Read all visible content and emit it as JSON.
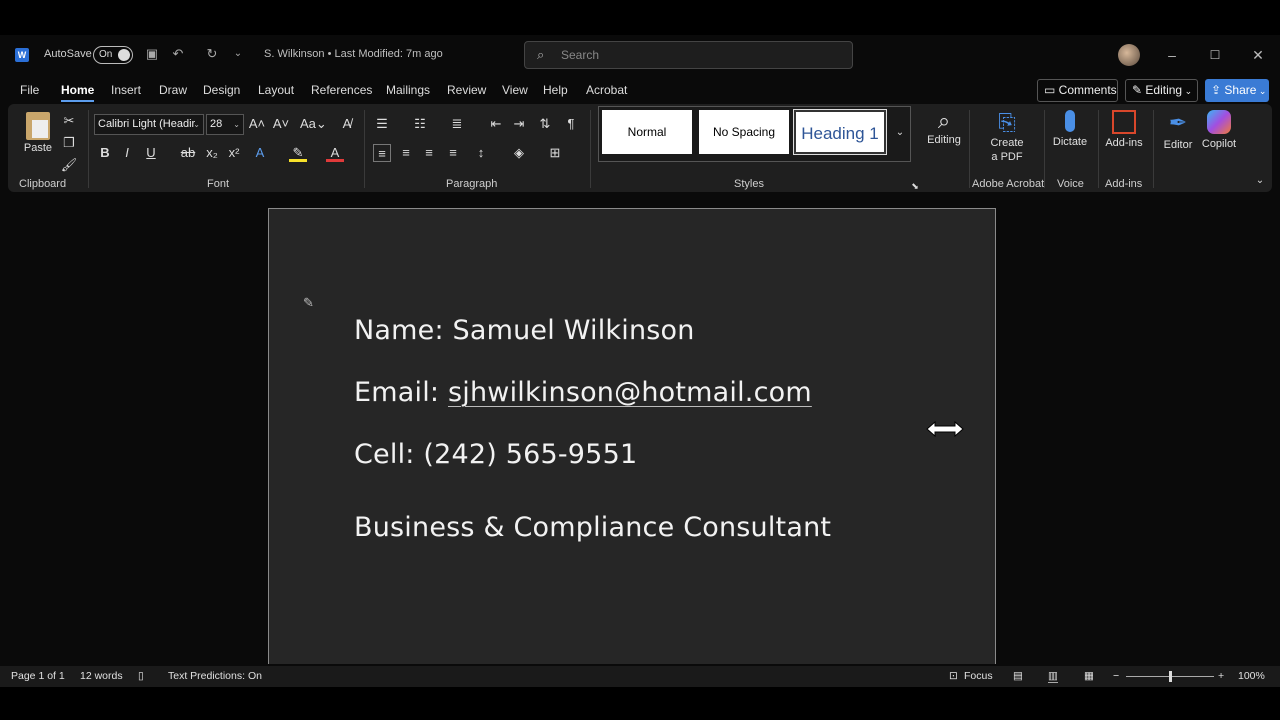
{
  "titlebar": {
    "autosave_label": "AutoSave",
    "autosave_state": "On",
    "doc_title": "S. Wilkinson  •  Last Modified: 7m ago",
    "search_placeholder": "Search"
  },
  "tabs": [
    "File",
    "Home",
    "Insert",
    "Draw",
    "Design",
    "Layout",
    "References",
    "Mailings",
    "Review",
    "View",
    "Help",
    "Acrobat"
  ],
  "active_tab": "Home",
  "actions": {
    "comments": "Comments",
    "editing": "Editing",
    "share": "Share"
  },
  "ribbon": {
    "clipboard": {
      "paste": "Paste",
      "label": "Clipboard"
    },
    "font": {
      "family": "Calibri Light (Headir",
      "size": "28",
      "label": "Font"
    },
    "paragraph": {
      "label": "Paragraph"
    },
    "styles": {
      "items": [
        "Normal",
        "No Spacing",
        "Heading 1"
      ],
      "label": "Styles"
    },
    "editing": {
      "label": "Editing"
    },
    "acrobat": {
      "create_pdf": "Create\na PDF",
      "label": "Adobe Acrobat"
    },
    "voice": {
      "dictate": "Dictate",
      "label": "Voice"
    },
    "addins": {
      "item": "Add-ins",
      "label": "Add-ins"
    },
    "editor": "Editor",
    "copilot": "Copilot"
  },
  "document": {
    "name_line": "Name: Samuel Wilkinson",
    "email_prefix": "Email: ",
    "email": "sjhwilkinson@hotmail.com",
    "cell_line": "Cell: (242) 565-9551",
    "title_line": "Business & Compliance Consultant"
  },
  "status": {
    "page": "Page 1 of 1",
    "words": "12 words",
    "predictions": "Text Predictions: On",
    "focus": "Focus",
    "zoom": "100%",
    "zoom_level": 1.0
  },
  "colors": {
    "accent": "#5c9ded",
    "share": "#3a7bd5",
    "page_bg": "#262626"
  }
}
